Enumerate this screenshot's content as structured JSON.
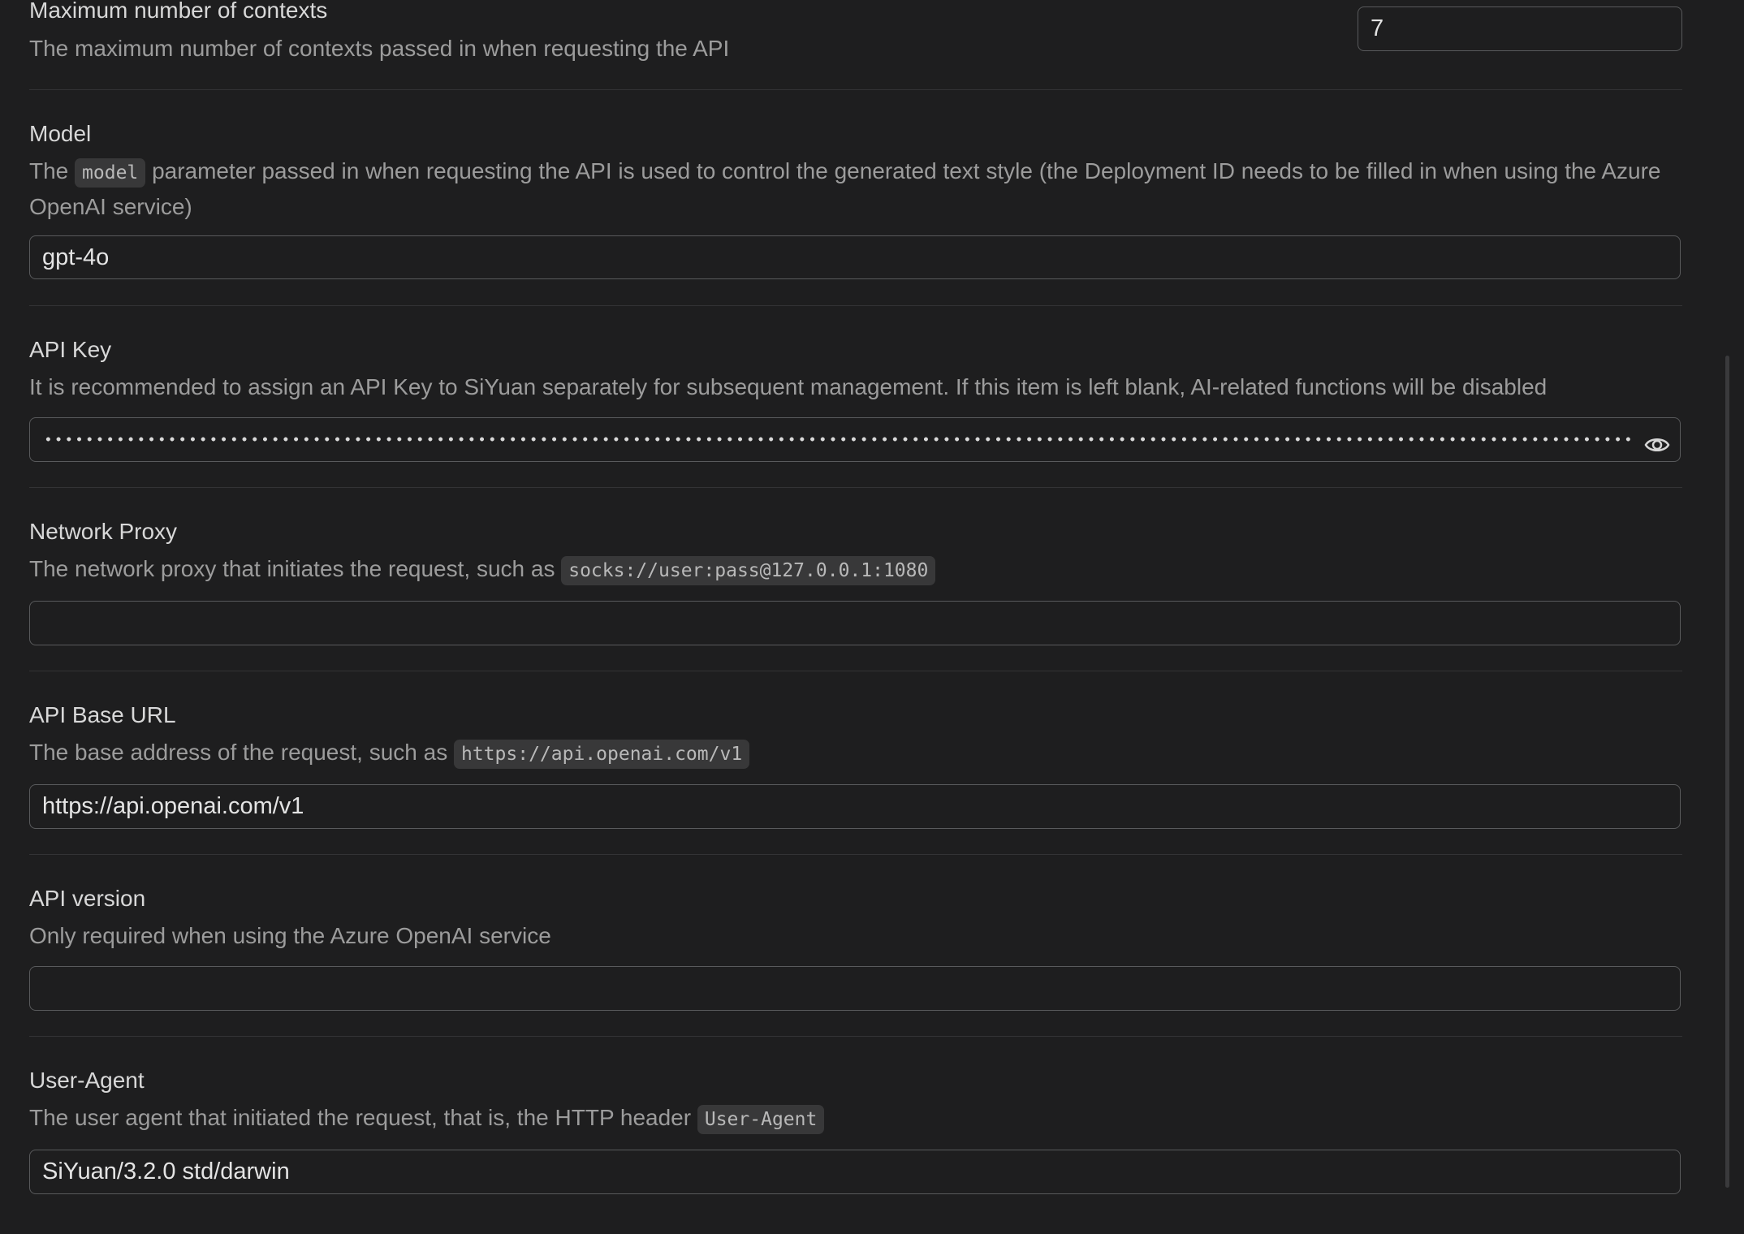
{
  "sections": {
    "max_contexts": {
      "title": "Maximum number of contexts",
      "description": "The maximum number of contexts passed in when requesting the API",
      "value": "7"
    },
    "model": {
      "title": "Model",
      "description_prefix": "The",
      "code": "model",
      "description_suffix": "parameter passed in when requesting the API is used to control the generated text style (the Deployment ID needs to be filled in when using the Azure OpenAI service)",
      "value": "gpt-4o"
    },
    "api_key": {
      "title": "API Key",
      "description": "It is recommended to assign an API Key to SiYuan separately for subsequent management. If this item is left blank, AI-related functions will be disabled",
      "value_masked": "••••••••••••••••••••••••••••••••••••••••••••••••••••••••••••••••••••••••••••••••••••••••••••••••••••••••••••••••••••••••••••••••••••••••••••••••••••••",
      "toggle_icon": "eye-icon"
    },
    "network_proxy": {
      "title": "Network Proxy",
      "description_prefix": "The network proxy that initiates the request, such as",
      "code": "socks://user:pass@127.0.0.1:1080",
      "value": ""
    },
    "api_base_url": {
      "title": "API Base URL",
      "description_prefix": "The base address of the request, such as",
      "code": "https://api.openai.com/v1",
      "value": "https://api.openai.com/v1"
    },
    "api_version": {
      "title": "API version",
      "description": "Only required when using the Azure OpenAI service",
      "value": ""
    },
    "user_agent": {
      "title": "User-Agent",
      "description_prefix": "The user agent that initiated the request, that is, the HTTP header",
      "code": "User-Agent",
      "value": "SiYuan/3.2.0 std/darwin"
    }
  },
  "colors": {
    "background": "#1e1e1f",
    "input_border": "#595a5c",
    "description": "#9c9c9c",
    "code_background": "#383839",
    "divider": "#333335"
  }
}
